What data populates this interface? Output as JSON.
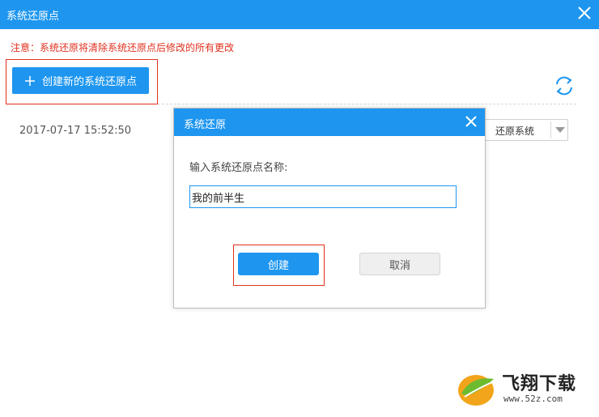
{
  "window": {
    "title": "系统还原点"
  },
  "notice": "注意：系统还原将清除系统还原点后修改的所有更改",
  "toolbar": {
    "create_new_label": "创建新的系统还原点"
  },
  "restore_points": [
    {
      "time": "2017-07-17 15:52:50",
      "action_label": "还原系统"
    }
  ],
  "dialog": {
    "title": "系统还原",
    "prompt": "输入系统还原点名称:",
    "input_value": "我的前半生",
    "create_label": "创建",
    "cancel_label": "取消"
  },
  "watermark": {
    "brand": "飞翔下载",
    "url": "www.52z.com"
  },
  "colors": {
    "accent": "#1e96f0",
    "warning": "#e0301e"
  }
}
